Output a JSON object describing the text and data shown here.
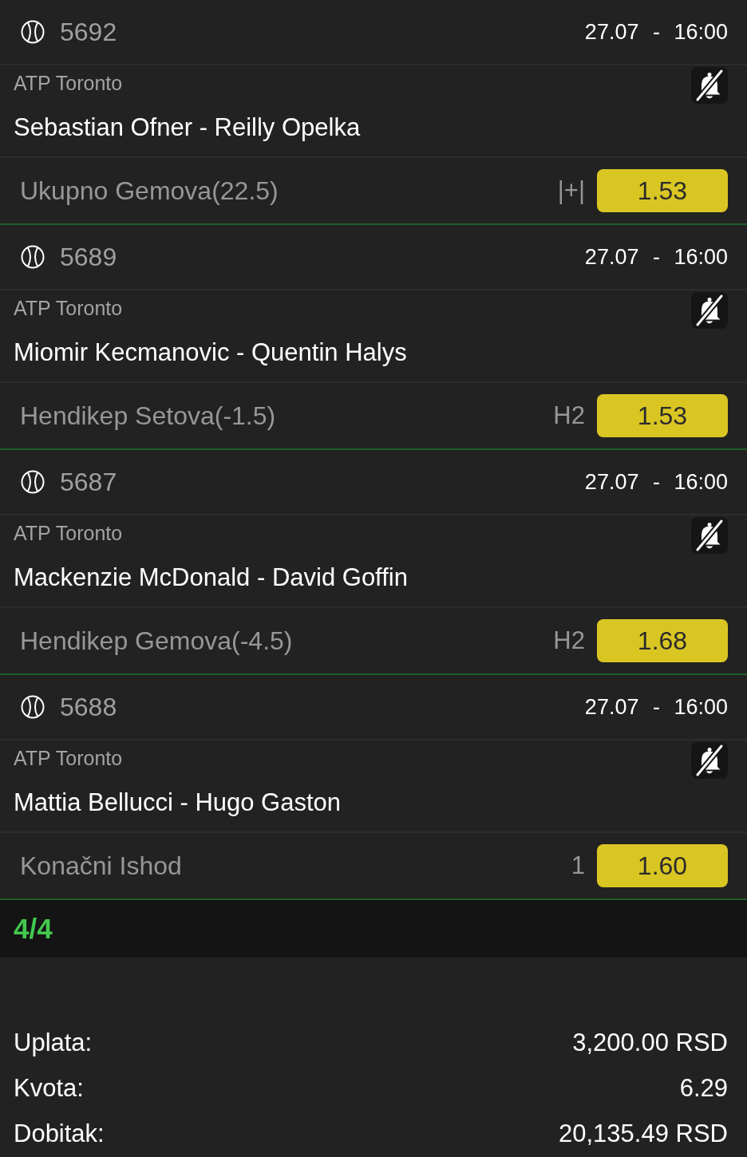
{
  "bets": [
    {
      "number": "5692",
      "datetime": "27.07 - 16:00",
      "league": "ATP Toronto",
      "notifications_muted": true,
      "match": "Sebastian Ofner - Reilly Opelka",
      "market": "Ukupno Gemova(22.5)",
      "pick": "|+|",
      "odds": "1.53"
    },
    {
      "number": "5689",
      "datetime": "27.07 - 16:00",
      "league": "ATP Toronto",
      "notifications_muted": true,
      "match": "Miomir Kecmanovic - Quentin Halys",
      "market": "Hendikep Setova(-1.5)",
      "pick": "H2",
      "odds": "1.53"
    },
    {
      "number": "5687",
      "datetime": "27.07 - 16:00",
      "league": "ATP Toronto",
      "notifications_muted": true,
      "match": "Mackenzie McDonald - David Goffin",
      "market": "Hendikep Gemova(-4.5)",
      "pick": "H2",
      "odds": "1.68"
    },
    {
      "number": "5688",
      "datetime": "27.07 - 16:00",
      "league": "ATP Toronto",
      "notifications_muted": true,
      "match": "Mattia Bellucci - Hugo Gaston",
      "market": "Konačni Ishod",
      "pick": "1",
      "odds": "1.60"
    }
  ],
  "ticket_count": "4/4",
  "summary": [
    {
      "label": "Uplata:",
      "value": "3,200.00 RSD"
    },
    {
      "label": "Kvota:",
      "value": "6.29"
    },
    {
      "label": "Dobitak:",
      "value": "20,135.49 RSD"
    }
  ]
}
